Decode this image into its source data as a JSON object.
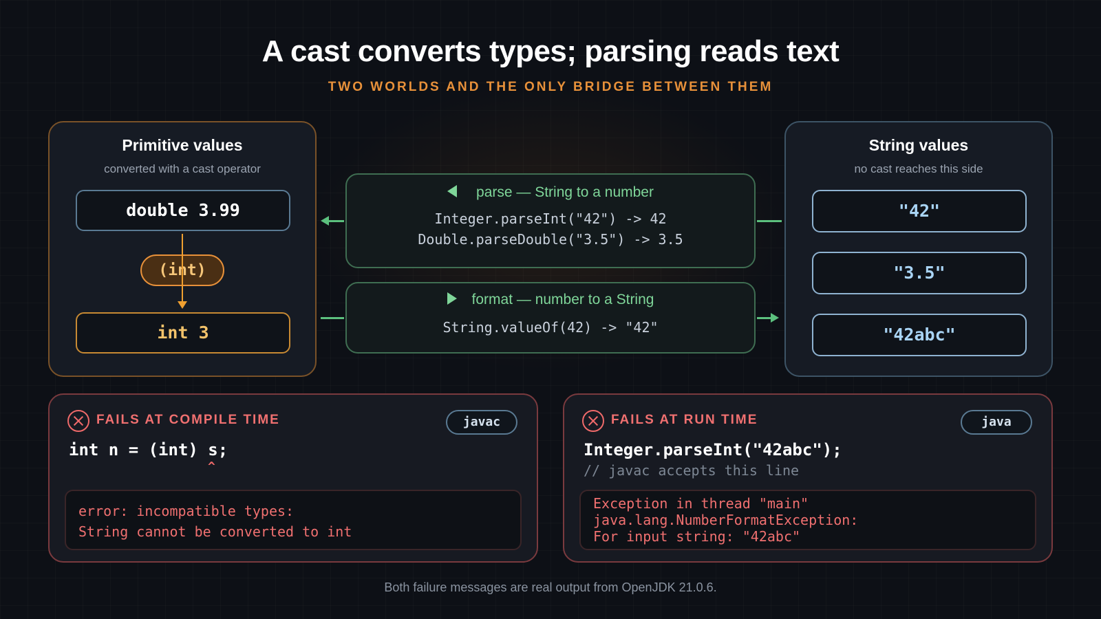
{
  "title": "A cast converts types; parsing reads text",
  "subtitle": "TWO WORLDS AND THE ONLY BRIDGE BETWEEN THEM",
  "primitive_panel": {
    "title": "Primitive values",
    "subtitle": "converted with a cast operator",
    "from_value": "double 3.99",
    "cast_operator": "(int)",
    "to_value": "int 3"
  },
  "string_panel": {
    "title": "String values",
    "subtitle": "no cast reaches this side",
    "values": [
      "\"42\"",
      "\"3.5\"",
      "\"42abc\""
    ]
  },
  "parse_bridge": {
    "heading": "parse — String to a number",
    "lines": [
      "Integer.parseInt(\"42\") -> 42",
      "Double.parseDouble(\"3.5\") -> 3.5"
    ]
  },
  "format_bridge": {
    "heading": "format — number to a String",
    "lines": [
      "String.valueOf(42) -> \"42\""
    ]
  },
  "compile_fail": {
    "heading": "FAILS AT COMPILE TIME",
    "tool": "javac",
    "code": "int n = (int) s;",
    "caret": "^",
    "error_lines": [
      "error: incompatible types:",
      "String cannot be converted to int"
    ]
  },
  "runtime_fail": {
    "heading": "FAILS AT RUN TIME",
    "tool": "java",
    "code": "Integer.parseInt(\"42abc\");",
    "comment": "// javac accepts this line",
    "error_lines": [
      "Exception in thread \"main\"",
      "java.lang.NumberFormatException:",
      "For input string: \"42abc\""
    ]
  },
  "footer": "Both failure messages are real output from OpenJDK 21.0.6.",
  "colors": {
    "background": "#0d1016",
    "accent_orange": "#e8913a",
    "bridge_green": "#7fd699",
    "error_red": "#f07070",
    "string_blue": "#a9d4f5"
  }
}
